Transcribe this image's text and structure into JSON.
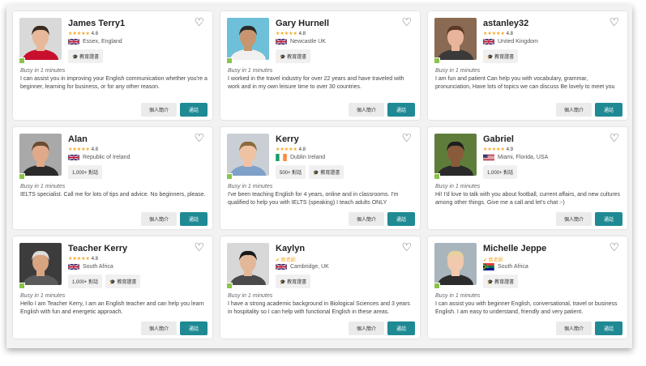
{
  "tutors": [
    {
      "name": "James Terry1",
      "rating": "4.8",
      "stars": "★★★★★",
      "new_label": "",
      "country": "gb",
      "location": "Essex, England",
      "tags": [
        "教育證書"
      ],
      "busy": "Busy in 1 minutes",
      "description": "I can assist you in improving your English communication whether you're a beginner, learning for business, or for any other reason.",
      "intro_label": "個人簡介",
      "call_label": "通話",
      "photo": {
        "bg": "#d9d9d9",
        "skin": "#e7b89a",
        "hair": "#3b2a20",
        "shirt": "#c8102e"
      }
    },
    {
      "name": "Gary Hurnell",
      "rating": "4.8",
      "stars": "★★★★★",
      "new_label": "",
      "country": "gb",
      "location": "Newcastle UK",
      "tags": [
        "教育證書"
      ],
      "busy": "Busy in 1 minutes",
      "description": "I worked in the travel industry for over 22 years and have traveled with work and in my own leisure time to over 30 countries.",
      "intro_label": "個人簡介",
      "call_label": "通話",
      "photo": {
        "bg": "#6ec0d8",
        "skin": "#c9956f",
        "hair": "#2a2a2a",
        "shirt": "#f0f0f0"
      }
    },
    {
      "name": "astanley32",
      "rating": "4.8",
      "stars": "★★★★★",
      "new_label": "",
      "country": "gb",
      "location": "United Kingdom",
      "tags": [
        "教育證書"
      ],
      "busy": "Busy in 1 minutes",
      "description": "I am fun and patient Can help you with vocabulary, grammar, pronunciation, Have lots of topics we can discuss Be lovely to meet you",
      "intro_label": "個人簡介",
      "call_label": "通話",
      "photo": {
        "bg": "#8a6a52",
        "skin": "#e9b59a",
        "hair": "#5a3a25",
        "shirt": "#3a3a3a"
      }
    },
    {
      "name": "Alan",
      "rating": "4.8",
      "stars": "★★★★★",
      "new_label": "",
      "country": "gb",
      "location": "Republic of Ireland",
      "tags": [
        "1,000+ 對話"
      ],
      "busy": "Busy in 1 minutes",
      "description": "IELTS specialist. Call me for lots of tips and advice. No beginners, please.",
      "intro_label": "個人簡介",
      "call_label": "通話",
      "photo": {
        "bg": "#a9a9a9",
        "skin": "#e0a98a",
        "hair": "#6b4a2e",
        "shirt": "#2b2b2b"
      }
    },
    {
      "name": "Kerry",
      "rating": "4.8",
      "stars": "★★★★★",
      "new_label": "",
      "country": "ie",
      "location": "Dublin Ireland",
      "tags": [
        "500+ 對話",
        "教育證書"
      ],
      "busy": "Busy in 1 minutes",
      "description": "I've been teaching English for 4 years, online and in classrooms. I'm qualified to help you with IELTS (speaking) I teach adults ONLY",
      "intro_label": "個人簡介",
      "call_label": "通話",
      "photo": {
        "bg": "#c9cfd4",
        "skin": "#f0c2a4",
        "hair": "#8b6a3e",
        "shirt": "#7fa0c8"
      }
    },
    {
      "name": "Gabriel",
      "rating": "4.9",
      "stars": "★★★★★",
      "new_label": "",
      "country": "us",
      "location": "Miami, Florida, USA",
      "tags": [
        "1,000+ 對話"
      ],
      "busy": "Busy in 1 minutes",
      "description": "Hi! I'd love to talk with you about football, current affairs, and new cultures among other things. Give me a call and let's chat :-)",
      "intro_label": "個人簡介",
      "call_label": "通話",
      "photo": {
        "bg": "#5f7d3a",
        "skin": "#8a5a3c",
        "hair": "#1e1e1e",
        "shirt": "#2a2a2a"
      }
    },
    {
      "name": "Teacher Kerry",
      "rating": "4.8",
      "stars": "★★★★★",
      "new_label": "",
      "country": "gb",
      "location": "South Africa",
      "tags": [
        "1,000+ 對話",
        "教育證書"
      ],
      "busy": "Busy in 1 minutes",
      "description": "Hello I am Teacher Kerry, I am an English teacher and can help you learn English with fun and energetic approach.",
      "intro_label": "個人簡介",
      "call_label": "通話",
      "photo": {
        "bg": "#3c3c3c",
        "skin": "#d9a580",
        "hair": "#dcdcdc",
        "shirt": "#5a5a5a"
      }
    },
    {
      "name": "Kaylyn",
      "rating": "",
      "stars": "",
      "new_label": "新老師",
      "country": "gb",
      "location": "Cambridge, UK",
      "tags": [
        "教育證書"
      ],
      "busy": "Busy in 1 minutes",
      "description": "I have a strong academic background in Biological Sciences and 3 years in hospitality so I can help with functional English in these areas.",
      "intro_label": "個人簡介",
      "call_label": "通話",
      "photo": {
        "bg": "#d8d8d8",
        "skin": "#e3b898",
        "hair": "#1a1a1a",
        "shirt": "#4a4a4a"
      }
    },
    {
      "name": "Michelle Jeppe",
      "rating": "",
      "stars": "",
      "new_label": "新老師",
      "country": "za",
      "location": "South Africa",
      "tags": [
        "教育證書"
      ],
      "busy": "Busy in 1 minutes",
      "description": "I can assist you with beginner English, conversational, travel or business English. I am easy to understand, friendly and very patient.",
      "intro_label": "個人簡介",
      "call_label": "通話",
      "photo": {
        "bg": "#a8b5bd",
        "skin": "#f1c9ad",
        "hair": "#e6d29a",
        "shirt": "#2c2c2c"
      }
    }
  ]
}
